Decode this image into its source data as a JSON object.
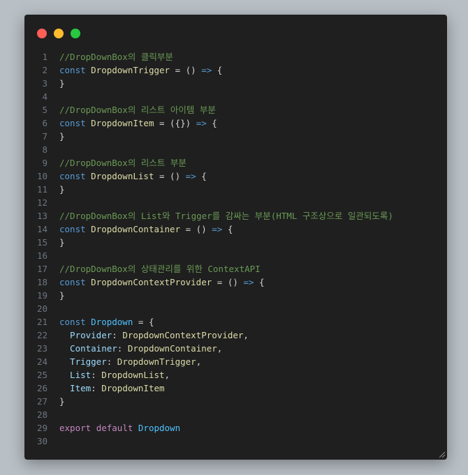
{
  "window": {
    "buttons": [
      {
        "name": "close",
        "color": "#ff5f57"
      },
      {
        "name": "minimize",
        "color": "#febc2e"
      },
      {
        "name": "maximize",
        "color": "#28c840"
      }
    ]
  },
  "colors": {
    "comment": "#6a9955",
    "keyword": "#569cd6",
    "function": "#dcdcaa",
    "variable": "#4fc1ff",
    "property": "#9cdcfe",
    "plain": "#d4d4d4",
    "arrow": "#569cd6",
    "control": "#c586c0",
    "line_number": "#6e7681"
  },
  "code_lines": [
    {
      "n": "1",
      "tokens": [
        {
          "t": "//DropDownBox의 클릭부분",
          "c": "comment"
        }
      ]
    },
    {
      "n": "2",
      "tokens": [
        {
          "t": "const ",
          "c": "keyword"
        },
        {
          "t": "DropdownTrigger",
          "c": "function"
        },
        {
          "t": " = () ",
          "c": "plain"
        },
        {
          "t": "=>",
          "c": "arrow"
        },
        {
          "t": " {",
          "c": "plain"
        }
      ]
    },
    {
      "n": "3",
      "tokens": [
        {
          "t": "}",
          "c": "plain"
        }
      ]
    },
    {
      "n": "4",
      "tokens": []
    },
    {
      "n": "5",
      "tokens": [
        {
          "t": "//DropDownBox의 리스트 아이템 부분",
          "c": "comment"
        }
      ]
    },
    {
      "n": "6",
      "tokens": [
        {
          "t": "const ",
          "c": "keyword"
        },
        {
          "t": "DropdownItem",
          "c": "function"
        },
        {
          "t": " = ({}) ",
          "c": "plain"
        },
        {
          "t": "=>",
          "c": "arrow"
        },
        {
          "t": " {",
          "c": "plain"
        }
      ]
    },
    {
      "n": "7",
      "tokens": [
        {
          "t": "}",
          "c": "plain"
        }
      ]
    },
    {
      "n": "8",
      "tokens": []
    },
    {
      "n": "9",
      "tokens": [
        {
          "t": "//DropDownBox의 리스트 부분",
          "c": "comment"
        }
      ]
    },
    {
      "n": "10",
      "tokens": [
        {
          "t": "const ",
          "c": "keyword"
        },
        {
          "t": "DropdownList",
          "c": "function"
        },
        {
          "t": " = () ",
          "c": "plain"
        },
        {
          "t": "=>",
          "c": "arrow"
        },
        {
          "t": " {",
          "c": "plain"
        }
      ]
    },
    {
      "n": "11",
      "tokens": [
        {
          "t": "}",
          "c": "plain"
        }
      ]
    },
    {
      "n": "12",
      "tokens": []
    },
    {
      "n": "13",
      "tokens": [
        {
          "t": "//DropDownBox의 List와 Trigger를 감싸는 부분(HTML 구조상으로 일관되도록)",
          "c": "comment"
        }
      ]
    },
    {
      "n": "14",
      "tokens": [
        {
          "t": "const ",
          "c": "keyword"
        },
        {
          "t": "DropdownContainer",
          "c": "function"
        },
        {
          "t": " = () ",
          "c": "plain"
        },
        {
          "t": "=>",
          "c": "arrow"
        },
        {
          "t": " {",
          "c": "plain"
        }
      ]
    },
    {
      "n": "15",
      "tokens": [
        {
          "t": "}",
          "c": "plain"
        }
      ]
    },
    {
      "n": "16",
      "tokens": []
    },
    {
      "n": "17",
      "tokens": [
        {
          "t": "//DropDownBox의 상태관리를 위한 ContextAPI",
          "c": "comment"
        }
      ]
    },
    {
      "n": "18",
      "tokens": [
        {
          "t": "const ",
          "c": "keyword"
        },
        {
          "t": "DropdownContextProvider",
          "c": "function"
        },
        {
          "t": " = () ",
          "c": "plain"
        },
        {
          "t": "=>",
          "c": "arrow"
        },
        {
          "t": " {",
          "c": "plain"
        }
      ]
    },
    {
      "n": "19",
      "tokens": [
        {
          "t": "}",
          "c": "plain"
        }
      ]
    },
    {
      "n": "20",
      "tokens": []
    },
    {
      "n": "21",
      "tokens": [
        {
          "t": "const ",
          "c": "keyword"
        },
        {
          "t": "Dropdown",
          "c": "variable"
        },
        {
          "t": " = {",
          "c": "plain"
        }
      ]
    },
    {
      "n": "22",
      "tokens": [
        {
          "t": "  Provider",
          "c": "property"
        },
        {
          "t": ": ",
          "c": "plain"
        },
        {
          "t": "DropdownContextProvider",
          "c": "function"
        },
        {
          "t": ",",
          "c": "plain"
        }
      ]
    },
    {
      "n": "23",
      "tokens": [
        {
          "t": "  Container",
          "c": "property"
        },
        {
          "t": ": ",
          "c": "plain"
        },
        {
          "t": "DropdownContainer",
          "c": "function"
        },
        {
          "t": ",",
          "c": "plain"
        }
      ]
    },
    {
      "n": "24",
      "tokens": [
        {
          "t": "  Trigger",
          "c": "property"
        },
        {
          "t": ": ",
          "c": "plain"
        },
        {
          "t": "DropdownTrigger",
          "c": "function"
        },
        {
          "t": ",",
          "c": "plain"
        }
      ]
    },
    {
      "n": "25",
      "tokens": [
        {
          "t": "  List",
          "c": "property"
        },
        {
          "t": ": ",
          "c": "plain"
        },
        {
          "t": "DropdownList",
          "c": "function"
        },
        {
          "t": ",",
          "c": "plain"
        }
      ]
    },
    {
      "n": "26",
      "tokens": [
        {
          "t": "  Item",
          "c": "property"
        },
        {
          "t": ": ",
          "c": "plain"
        },
        {
          "t": "DropdownItem",
          "c": "function"
        }
      ]
    },
    {
      "n": "27",
      "tokens": [
        {
          "t": "}",
          "c": "plain"
        }
      ]
    },
    {
      "n": "28",
      "tokens": []
    },
    {
      "n": "29",
      "tokens": [
        {
          "t": "export ",
          "c": "control"
        },
        {
          "t": "default ",
          "c": "control"
        },
        {
          "t": "Dropdown",
          "c": "variable"
        }
      ]
    },
    {
      "n": "30",
      "tokens": []
    }
  ]
}
